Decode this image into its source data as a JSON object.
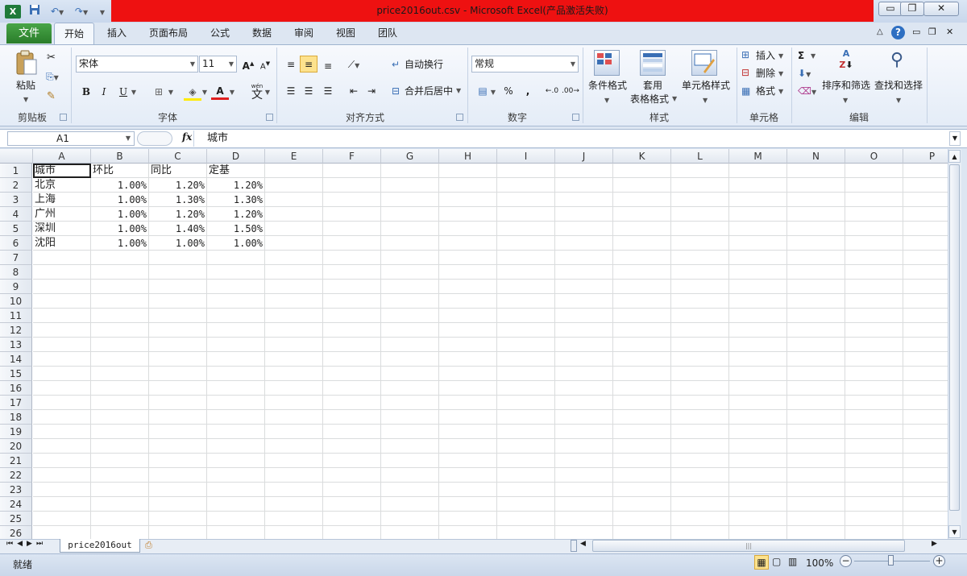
{
  "window": {
    "title": "price2016out.csv  -  Microsoft Excel(产品激活失败)",
    "accent_red": "#ee1111"
  },
  "quick_access": {
    "app_icon": "excel-icon",
    "save_icon": "save-icon",
    "undo_icon": "undo-icon",
    "redo_icon": "redo-icon",
    "customize_icon": "customize-icon"
  },
  "window_controls": {
    "minimize": "▭",
    "restore": "❐",
    "close": "✕"
  },
  "tabs": {
    "file": "文件",
    "items": [
      "开始",
      "插入",
      "页面布局",
      "公式",
      "数据",
      "审阅",
      "视图",
      "团队"
    ],
    "active": "开始"
  },
  "ribbon": {
    "clipboard": {
      "label": "剪贴板",
      "paste": "粘贴"
    },
    "font": {
      "label": "字体",
      "name": "宋体",
      "size": "11",
      "bold": "B",
      "italic": "I",
      "underline": "U",
      "grow": "A",
      "shrink": "A",
      "color_letter": "A",
      "wen": "wén",
      "wen_char": "文"
    },
    "alignment": {
      "label": "对齐方式",
      "wrap": "自动换行",
      "merge": "合并后居中"
    },
    "number": {
      "label": "数字",
      "format": "常规",
      "percent": "%",
      "comma": ","
    },
    "styles": {
      "label": "样式",
      "conditional": "条件格式",
      "table1": "套用",
      "table2": "表格格式",
      "cell_styles": "单元格样式"
    },
    "cells": {
      "label": "单元格",
      "insert": "插入",
      "delete": "删除",
      "format": "格式"
    },
    "editing": {
      "label": "编辑",
      "sigma": "Σ",
      "sort": "排序和筛选",
      "find": "查找和选择"
    }
  },
  "formula_bar": {
    "name_box": "A1",
    "fx": "fx",
    "content": "城市"
  },
  "columns": [
    "A",
    "B",
    "C",
    "D",
    "E",
    "F",
    "G",
    "H",
    "I",
    "J",
    "K",
    "L",
    "M",
    "N",
    "O",
    "P"
  ],
  "row_count": 26,
  "sheet": {
    "rows": [
      [
        "城市",
        "环比",
        "同比",
        "定基"
      ],
      [
        "北京",
        "1.00%",
        "1.20%",
        "1.20%"
      ],
      [
        "上海",
        "1.00%",
        "1.30%",
        "1.30%"
      ],
      [
        "广州",
        "1.00%",
        "1.20%",
        "1.20%"
      ],
      [
        "深圳",
        "1.00%",
        "1.40%",
        "1.50%"
      ],
      [
        "沈阳",
        "1.00%",
        "1.00%",
        "1.00%"
      ]
    ]
  },
  "sheet_tabs": {
    "active": "price2016out"
  },
  "status": {
    "ready": "就绪",
    "zoom": "100%",
    "minus": "−",
    "plus": "+"
  }
}
